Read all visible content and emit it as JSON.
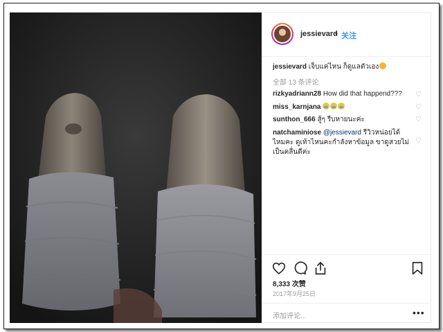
{
  "post": {
    "author": "jessievard",
    "follow_sep": "•",
    "follow_label": "关注",
    "caption_text": "เจ็บแค่ไหน ก็ดูแลตัวเอง"
  },
  "comments": {
    "view_all": "全部 13 条评论",
    "items": [
      {
        "user": "rizkyadriann28",
        "text": "How did that happend???"
      },
      {
        "user": "miss_karnjana",
        "text": ""
      },
      {
        "user": "sunthon_666",
        "text": "สู้ๆ รีบหายนะค่ะ"
      },
      {
        "user": "natchaminiose",
        "mention": "@jessievard",
        "text_line1": " รีวิวหน่อยได้",
        "text_line2": "ไหมคะ ดูเท้าไหนคะกำลังหาข้อมูล ขาดูสวยไม่",
        "text_line3": "เป็นคลื่นดีค่ะ"
      }
    ]
  },
  "stats": {
    "likes": "8,333 次赞",
    "date": "2017年9月25日"
  },
  "composer": {
    "placeholder": "添加评论...",
    "more": "•••"
  },
  "icons": {
    "like": "heart-icon",
    "comment": "comment-icon",
    "share": "share-icon",
    "save": "bookmark-icon"
  },
  "colors": {
    "link_blue": "#3897f0",
    "text": "#262626",
    "muted": "#999999",
    "border": "#efefef"
  }
}
